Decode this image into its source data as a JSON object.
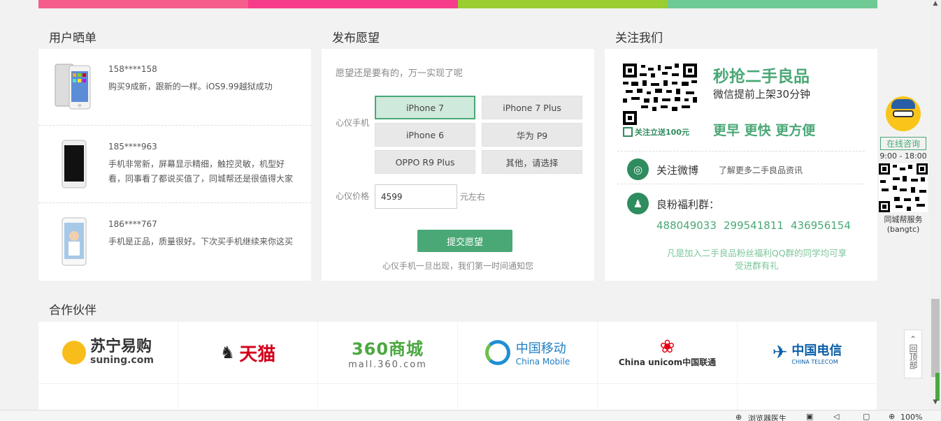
{
  "colors": {
    "stripe": [
      "#f65d8c",
      "#f63c8a",
      "#9acd32",
      "#6ec994"
    ],
    "accent": "#4aa876"
  },
  "reviews": {
    "title": "用户晒单",
    "items": [
      {
        "user": "158****158",
        "text": "购买9成新，跟新的一样。iOS9.99越狱成功"
      },
      {
        "user": "185****963",
        "text": "手机非常新，屏幕显示精细，触控灵敏，机型好看，同事看了都说买值了，同城帮还是很值得大家"
      },
      {
        "user": "186****767",
        "text": "手机是正品，质量很好。下次买手机继续来你这买"
      }
    ]
  },
  "wish": {
    "title": "发布愿望",
    "hint": "愿望还是要有的，万一实现了呢",
    "phone_label": "心仪手机",
    "options": [
      "iPhone 7",
      "iPhone 7 Plus",
      "iPhone 6",
      "华为 P9",
      "OPPO R9 Plus",
      "其他，请选择"
    ],
    "selected": "iPhone 7",
    "price_label": "心仪价格",
    "price_value": "4599",
    "price_unit": "元左右",
    "submit_label": "提交愿望",
    "note": "心仪手机一旦出现，我们第一时间通知您"
  },
  "follow": {
    "title": "关注我们",
    "qr_caption": "关注立送100元",
    "headline": "秒抢二手良品",
    "sub": "微信提前上架30分钟",
    "slogan": "更早 更快 更方便",
    "weibo_label": "关注微博",
    "weibo_desc": "了解更多二手良品资讯",
    "qq_label": "良粉福利群：",
    "qq_groups": [
      "488049033",
      "299541811",
      "436956154"
    ],
    "footnote_1": "凡是加入二手良品粉丝福利QQ群的同学均可享",
    "footnote_2": "受进群有礼"
  },
  "partners": {
    "title": "合作伙伴",
    "logos": [
      {
        "name": "苏宁易购",
        "sub": "suning.com",
        "icon": "suning-logo"
      },
      {
        "name": "天猫",
        "sub": "",
        "icon": "tmall-logo"
      },
      {
        "name": "360商城",
        "sub": "mall.360.com",
        "icon": "360-logo"
      },
      {
        "name": "中国移动",
        "sub": "China Mobile",
        "icon": "china-mobile-logo"
      },
      {
        "name": "China unicom中国联通",
        "sub": "",
        "icon": "unicom-logo"
      },
      {
        "name": "中国电信",
        "sub": "CHINA TELECOM",
        "icon": "telecom-logo"
      }
    ]
  },
  "side": {
    "online_label": "在线咨询",
    "hours": "9:00 - 18:00",
    "service": "同城帮服务",
    "account": "(bangtc)",
    "back_top": "回顶部"
  },
  "status": {
    "doctor": "浏览器医生",
    "zoom": "100%"
  }
}
